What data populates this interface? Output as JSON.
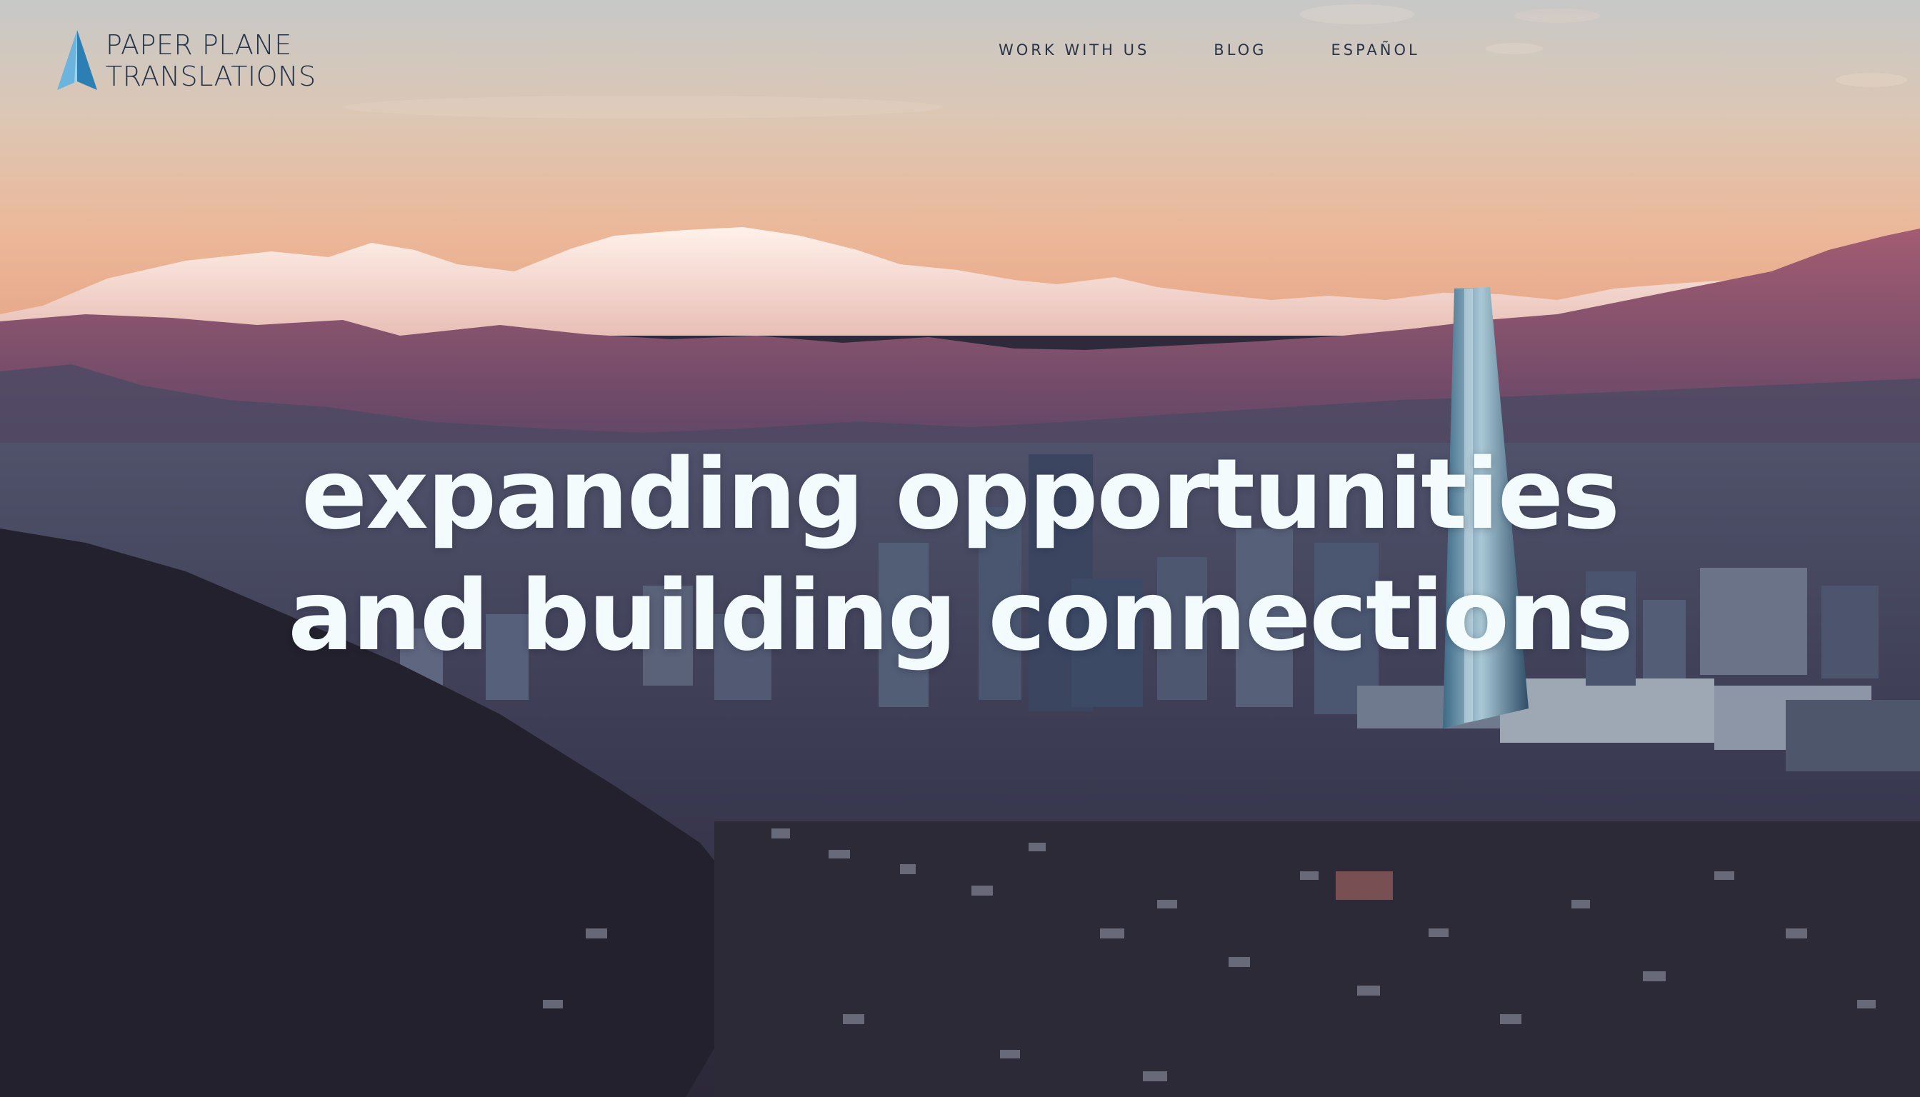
{
  "brand": {
    "line1": "PAPER PLANE",
    "line2": "TRANSLATIONS",
    "logo_icon": "paper-plane-icon",
    "accent_color": "#3f8fbf"
  },
  "nav": {
    "items": [
      {
        "label": "WORK WITH US"
      },
      {
        "label": "BLOG"
      },
      {
        "label": "ESPAÑOL"
      }
    ]
  },
  "hero": {
    "headline_line1": "expanding opportunities",
    "headline_line2": "and building connections",
    "headline_color": "#f4fbfd"
  }
}
